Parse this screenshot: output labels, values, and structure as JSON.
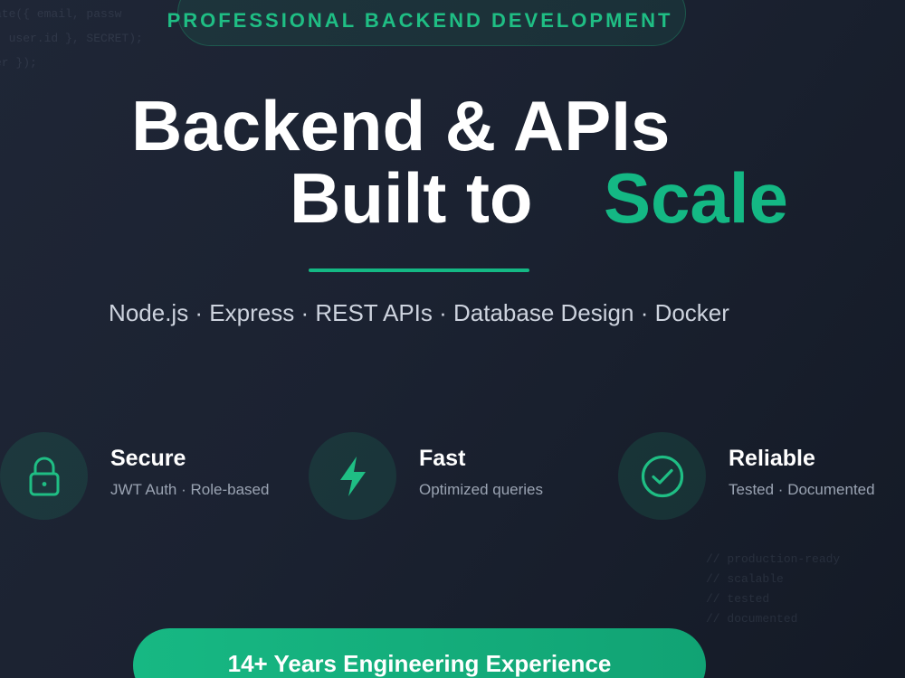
{
  "background": {
    "code_top": [
      "ate({ email, passw",
      "; user.id }, SECRET);",
      "er });"
    ],
    "code_bottom": [
      "// production-ready",
      "// scalable",
      "// tested",
      "// documented"
    ]
  },
  "badge": {
    "label": "PROFESSIONAL BACKEND DEVELOPMENT"
  },
  "hero": {
    "line1": "Backend & APIs",
    "line2": "Built to",
    "accent": "Scale"
  },
  "tech_stack": "Node.js · Express · REST APIs · Database Design · Docker",
  "features": [
    {
      "icon": "lock-icon",
      "title": "Secure",
      "subtitle": "JWT Auth · Role-based"
    },
    {
      "icon": "lightning-icon",
      "title": "Fast",
      "subtitle": "Optimized queries"
    },
    {
      "icon": "check-circle-icon",
      "title": "Reliable",
      "subtitle": "Tested · Documented"
    }
  ],
  "cta": {
    "label": "14+ Years Engineering Experience"
  },
  "colors": {
    "accent": "#14b884",
    "background": "#1b2231",
    "muted_text": "#9aa3b2"
  }
}
